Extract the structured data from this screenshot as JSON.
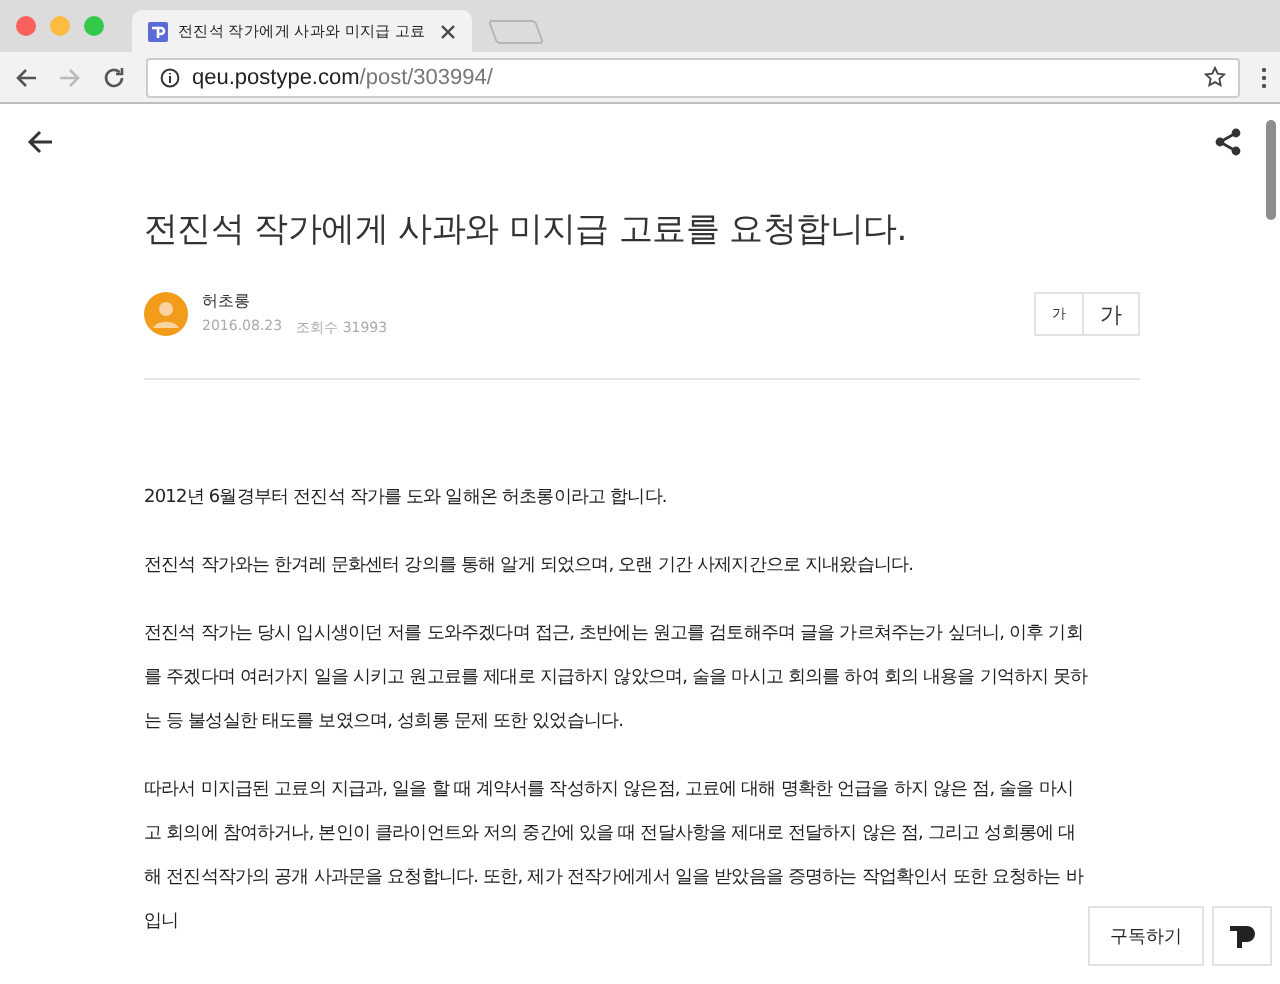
{
  "browser": {
    "tab_title": "전진석 작가에게 사과와 미지급 고료",
    "url_host": "qeu.postype.com",
    "url_path": "/post/303994/"
  },
  "post": {
    "title": "전진석 작가에게 사과와 미지급 고료를 요청합니다.",
    "author": "허초롱",
    "date": "2016.08.23",
    "views": "조회수 31993",
    "font_sizes": [
      "가",
      "가"
    ],
    "paragraphs": [
      "2012년 6월경부터 전진석 작가를 도와 일해온 허초롱이라고 합니다.",
      "전진석 작가와는 한겨레 문화센터 강의를 통해 알게 되었으며, 오랜 기간 사제지간으로 지내왔습니다.",
      "전진석 작가는 당시 입시생이던 저를 도와주겠다며 접근, 초반에는 원고를 검토해주며 글을 가르쳐주는가 싶더니, 이후 기회를 주겠다며 여러가지 일을 시키고 원고료를 제대로 지급하지 않았으며, 술을 마시고 회의를 하여 회의 내용을 기억하지 못하는 등 불성실한 태도를 보였으며, 성희롱 문제 또한 있었습니다.",
      "따라서 미지급된 고료의 지급과, 일을 할 때 계약서를 작성하지 않은점, 고료에 대해 명확한 언급을 하지 않은 점, 술을 마시고 회의에 참여하거나, 본인이 클라이언트와 저의 중간에 있을 때 전달사항을 제대로 전달하지 않은 점, 그리고 성희롱에 대해 전진석작가의 공개 사과문을 요청합니다. 또한, 제가 전작가에게서 일을 받았음을 증명하는 작업확인서 또한 요청하는 바입니"
    ]
  },
  "subscribe_button": "구독하기"
}
